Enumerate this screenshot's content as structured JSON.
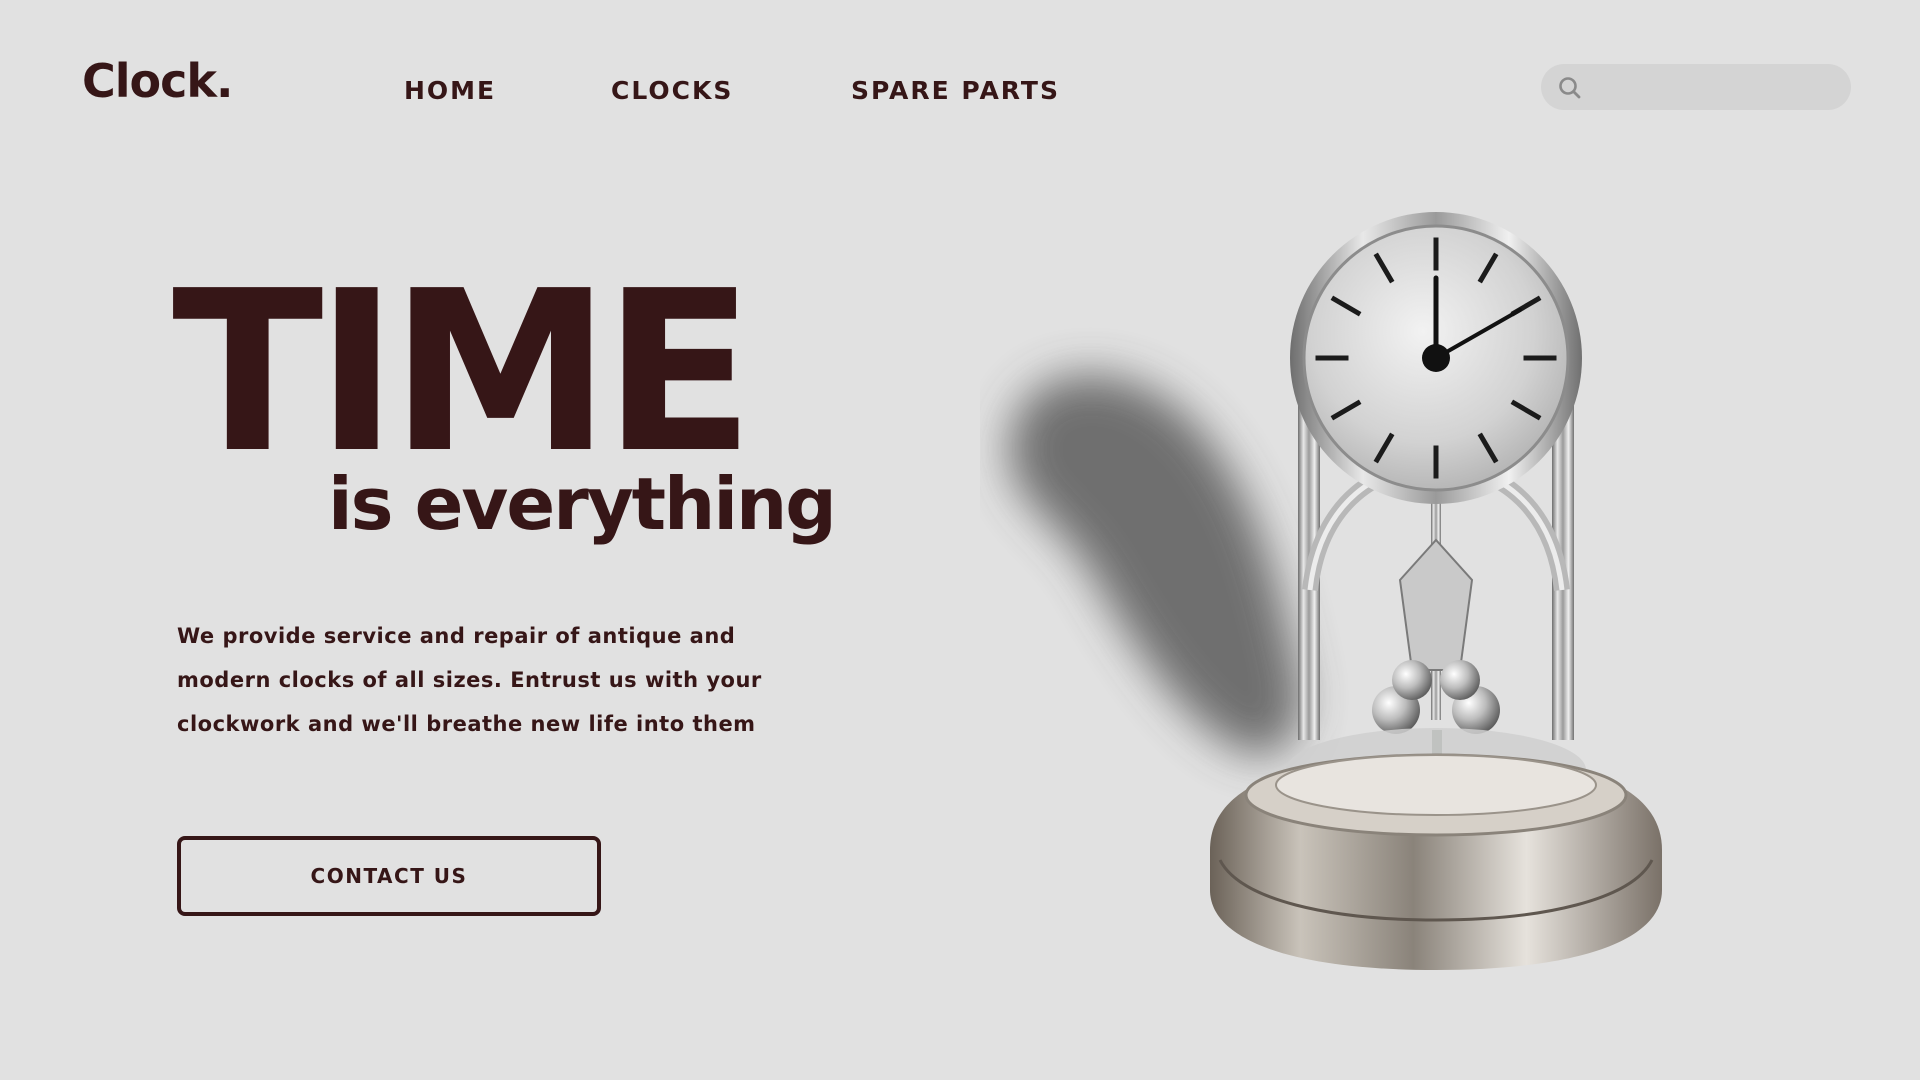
{
  "brand": {
    "logo": "Clock."
  },
  "nav": {
    "items": [
      {
        "label": "HOME"
      },
      {
        "label": "CLOCKS"
      },
      {
        "label": "SPARE PARTS"
      }
    ]
  },
  "search": {
    "placeholder": "",
    "value": "",
    "icon": "search-icon"
  },
  "hero": {
    "title": "TIME",
    "subtitle": "is everything",
    "description": "We provide service and repair of antique and modern clocks of all sizes. Entrust us with your clockwork and we'll breathe new life into them",
    "cta_label": "CONTACT US"
  },
  "colors": {
    "background": "#e1e1e1",
    "text": "#361617",
    "search_bg": "#d4d4d4"
  }
}
